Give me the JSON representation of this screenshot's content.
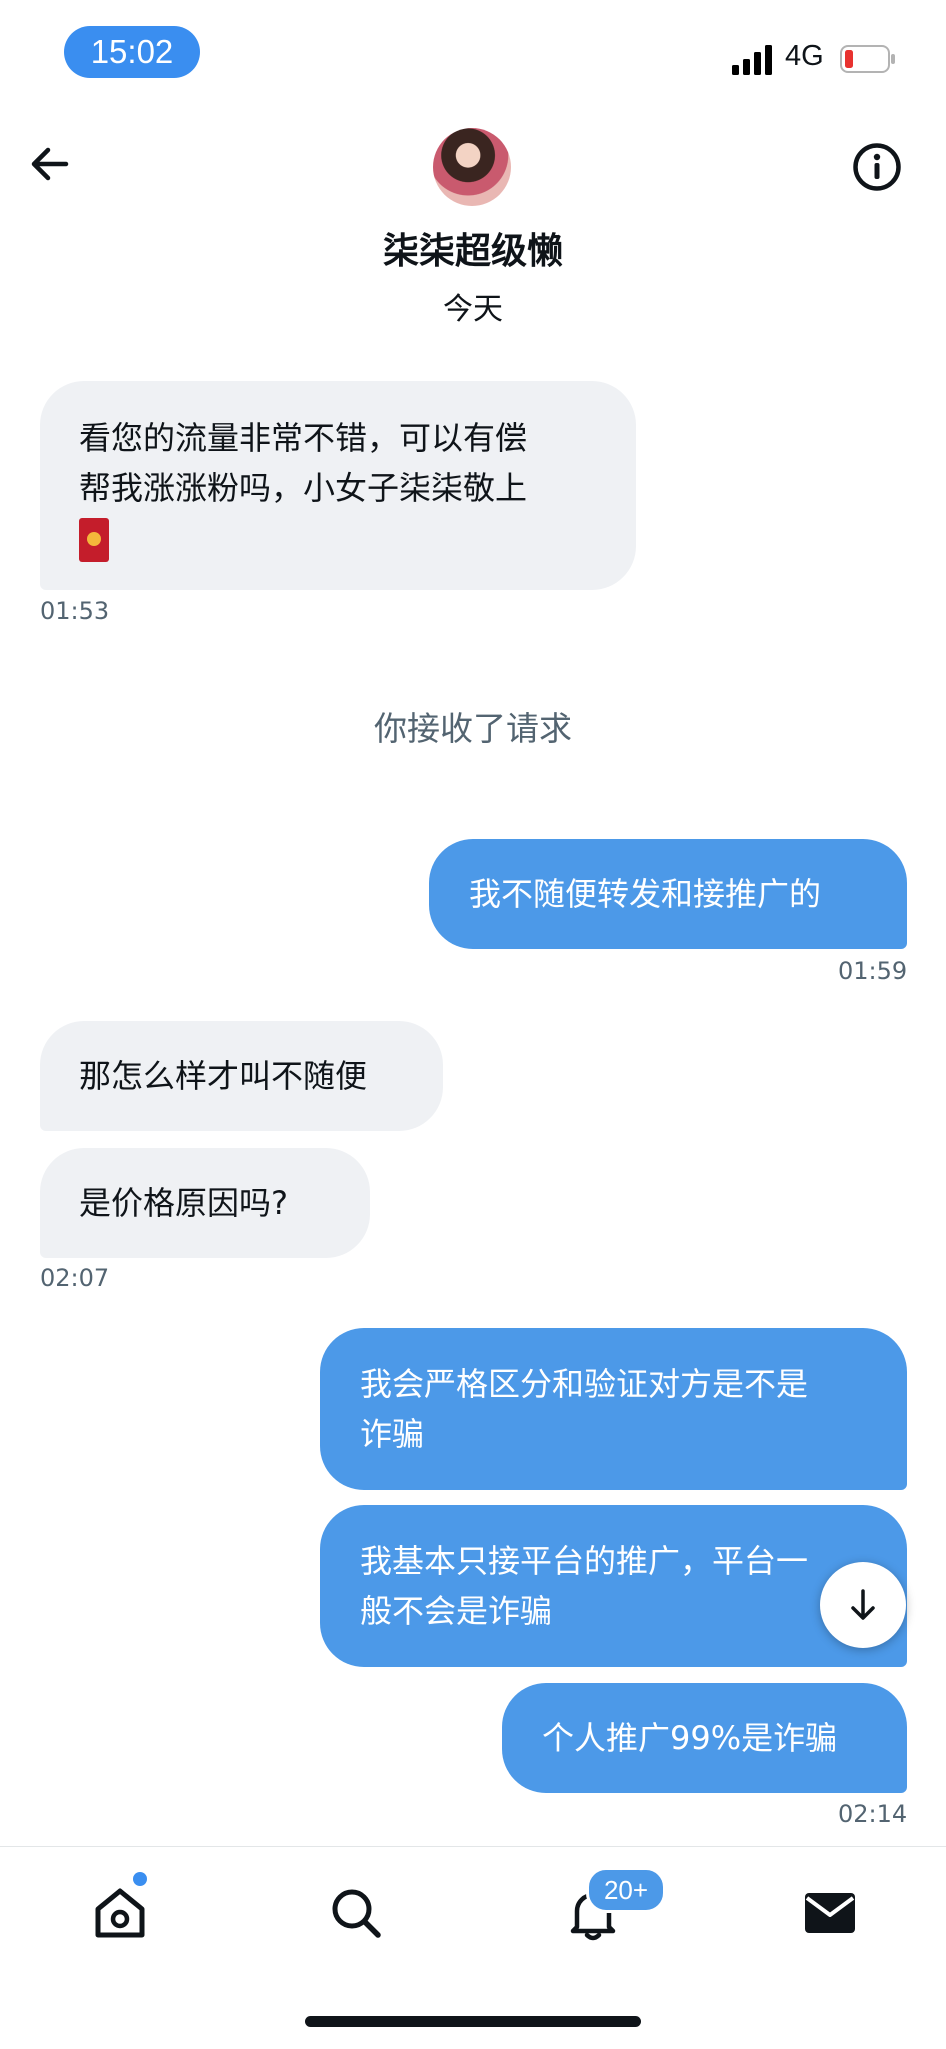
{
  "status_bar": {
    "time": "15:02",
    "network": "4G"
  },
  "header": {
    "name": "柒柒超级懒",
    "subtitle": "今天"
  },
  "messages": [
    {
      "text_line1": "看您的流量非常不错，可以有偿",
      "text_line2": "帮我涨涨粉吗，小女子柒柒敬上",
      "time": "01:53"
    },
    {
      "system": "你接收了请求"
    },
    {
      "text": "我不随便转发和接推广的",
      "time": "01:59"
    },
    {
      "text": "那怎么样才叫不随便"
    },
    {
      "text": "是价格原因吗?",
      "time": "02:07"
    },
    {
      "text_line1": "我会严格区分和验证对方是不是",
      "text_line2": "诈骗"
    },
    {
      "text_line1": "我基本只接平台的推广，平台一",
      "text_line2": "般不会是诈骗"
    },
    {
      "text": "个人推广99%是诈骗",
      "time": "02:14"
    }
  ],
  "nav": {
    "notifications_badge": "20+"
  },
  "colors": {
    "accent": "#4c99e8",
    "incoming_bubble": "#eff1f4",
    "time_pill": "#3a8ef0"
  }
}
